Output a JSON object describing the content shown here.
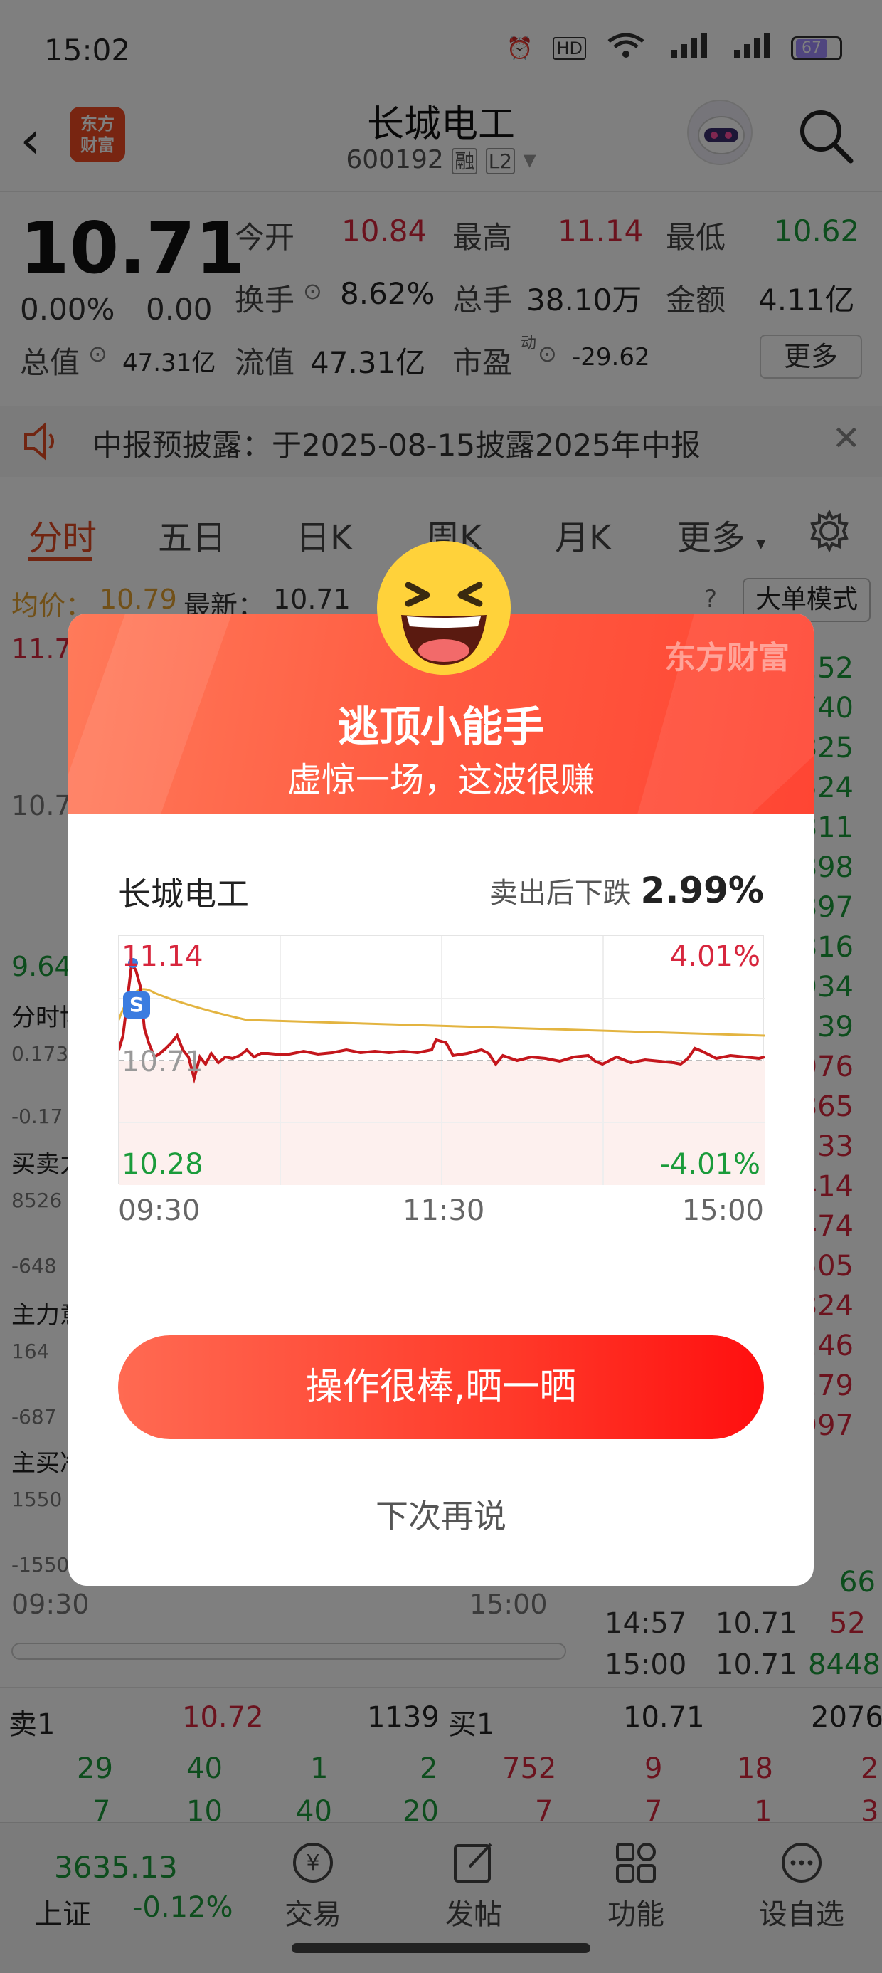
{
  "status": {
    "time": "15:02",
    "battery": "67"
  },
  "header": {
    "title": "长城电工",
    "code": "600192",
    "badge_rong": "融",
    "badge_level": "L2",
    "logo_text": "东方\n财富"
  },
  "quote": {
    "price": "10.71",
    "change_pct": "0.00%",
    "change": "0.00",
    "open_label": "今开",
    "open": "10.84",
    "high_label": "最高",
    "high": "11.14",
    "low_label": "最低",
    "low": "10.62",
    "turnover_label": "换手",
    "turnover": "8.62%",
    "volume_label": "总手",
    "volume": "38.10万",
    "amount_label": "金额",
    "amount": "4.11亿",
    "mktcap_label": "总值",
    "mktcap": "47.31亿",
    "float_label": "流值",
    "float": "47.31亿",
    "pe_label": "市盈",
    "pe_sup": "动",
    "pe": "-29.62",
    "more": "更多"
  },
  "notice": {
    "text": "中报预披露：于2025-08-15披露2025年中报"
  },
  "tabs": [
    "分时",
    "五日",
    "日K",
    "周K",
    "月K",
    "更多"
  ],
  "subbar": {
    "avg_label": "均价：",
    "avg": "10.79",
    "latest_label": "最新：",
    "latest": "10.71",
    "mode_button": "大单模式"
  },
  "background_chart": {
    "top_price": "11.7",
    "mid_price": "10.7",
    "low_price": "9.64",
    "sections": [
      "分时博",
      "买卖力",
      "主力意",
      "主买净"
    ],
    "vals": [
      "0.173",
      "-0.17",
      "8526",
      "-648",
      "164",
      "-687",
      "1550",
      "-1550"
    ],
    "time_start": "09:30",
    "time_end": "15:00"
  },
  "right_list": {
    "values": [
      "252",
      "740",
      "825",
      "524",
      "811",
      "898",
      "897",
      "816",
      "934",
      "39",
      "076",
      "865",
      "33",
      "414",
      "474",
      "505",
      "824",
      "246",
      "279",
      "997"
    ],
    "ticks": [
      {
        "time": "14:57",
        "price": "10.71",
        "vol": "52"
      },
      {
        "time": "15:00",
        "price": "10.71",
        "vol": "8448"
      }
    ],
    "tick_partial_vol": "66"
  },
  "orderbook": {
    "sell1_label": "卖1",
    "sell1_price": "10.72",
    "sell1_vol": "1139",
    "buy1_label": "买1",
    "buy1_price": "10.71",
    "buy1_vol": "2076",
    "sell_row2": [
      "29",
      "40",
      "1",
      "2"
    ],
    "sell_row3": [
      "7",
      "10",
      "40",
      "20"
    ],
    "buy_row2": [
      "752",
      "9",
      "18",
      "2"
    ],
    "buy_row3": [
      "7",
      "7",
      "1",
      "3"
    ]
  },
  "bottombar": {
    "index_value": "3635.13",
    "index_name": "上证",
    "index_change": "-0.12%",
    "items": [
      "交易",
      "发帖",
      "功能",
      "设自选"
    ]
  },
  "dialog": {
    "brand": "东方财富",
    "title": "逃顶小能手",
    "subtitle": "虚惊一场，这波很赚",
    "stock_name": "长城电工",
    "drop_label": "卖出后下跌",
    "drop_value": "2.99%",
    "chart_high": "11.14",
    "chart_mid": "10.71",
    "chart_low": "10.28",
    "chart_up_pct": "4.01%",
    "chart_down_pct": "-4.01%",
    "sell_marker": "S",
    "times": [
      "09:30",
      "11:30",
      "15:00"
    ],
    "share_button": "操作很棒,晒一晒",
    "later_button": "下次再说"
  },
  "colors": {
    "accent": "#e24a22",
    "up": "#d7263d",
    "down": "#1a9b3a",
    "avg_line": "#e3b440"
  }
}
